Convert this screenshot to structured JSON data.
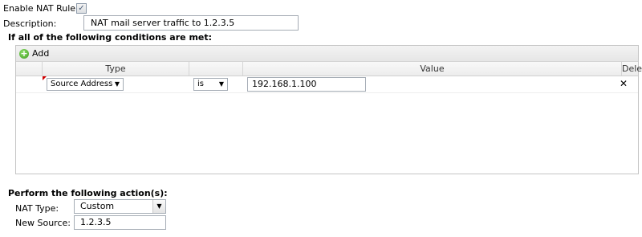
{
  "nat_rule": {
    "enable_label": "Enable NAT Rule:",
    "enabled": true,
    "description_label": "Description:",
    "description_value": "NAT mail server traffic to 1.2.3.5"
  },
  "conditions": {
    "heading": "If all of the following conditions are met:",
    "add_label": "Add",
    "columns": {
      "type": "Type",
      "value": "Value",
      "delete": "Delete"
    },
    "rows": [
      {
        "type": "Source Address",
        "operator": "is",
        "value": "192.168.1.100"
      }
    ]
  },
  "actions": {
    "heading": "Perform the following action(s):",
    "nat_type_label": "NAT Type:",
    "nat_type_value": "Custom",
    "new_source_label": "New Source:",
    "new_source_value": "1.2.3.5"
  },
  "icons": {
    "add": "add-icon",
    "delete": "delete-x-icon",
    "checkbox": "checkmark-icon",
    "dropdown": "chevron-down-icon"
  }
}
